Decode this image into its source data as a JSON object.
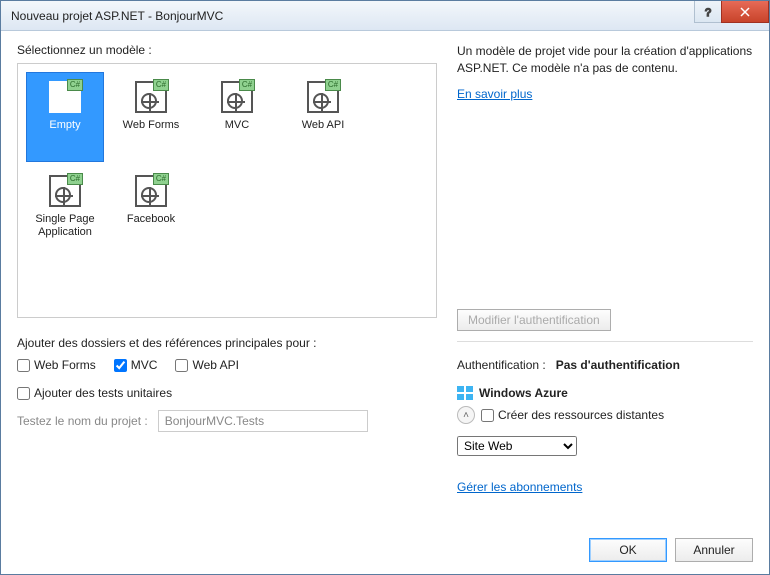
{
  "window": {
    "title": "Nouveau projet ASP.NET - BonjourMVC"
  },
  "left": {
    "select_label": "Sélectionnez un modèle :",
    "templates": [
      {
        "label": "Empty",
        "selected": true
      },
      {
        "label": "Web Forms",
        "selected": false
      },
      {
        "label": "MVC",
        "selected": false
      },
      {
        "label": "Web API",
        "selected": false
      },
      {
        "label": "Single Page Application",
        "selected": false
      },
      {
        "label": "Facebook",
        "selected": false
      }
    ],
    "folders_label": "Ajouter des dossiers et des références principales pour :",
    "folder_checks": {
      "webforms": {
        "label": "Web Forms",
        "checked": false
      },
      "mvc": {
        "label": "MVC",
        "checked": true
      },
      "webapi": {
        "label": "Web API",
        "checked": false
      }
    },
    "unit_tests": {
      "label": "Ajouter des tests unitaires",
      "checked": false
    },
    "test_name_label": "Testez le nom du projet :",
    "test_name_value": "BonjourMVC.Tests"
  },
  "right": {
    "description": "Un modèle de projet vide pour la création d'applications ASP.NET. Ce modèle n'a pas de contenu.",
    "learn_more": "En savoir plus",
    "modify_auth": "Modifier l'authentification",
    "auth_label": "Authentification :",
    "auth_value": "Pas d'authentification",
    "azure": {
      "title": "Windows Azure",
      "create_remote": {
        "label": "Créer des ressources distantes",
        "checked": false
      },
      "resource_type": "Site Web",
      "manage_subs": "Gérer les abonnements"
    }
  },
  "footer": {
    "ok": "OK",
    "cancel": "Annuler"
  }
}
